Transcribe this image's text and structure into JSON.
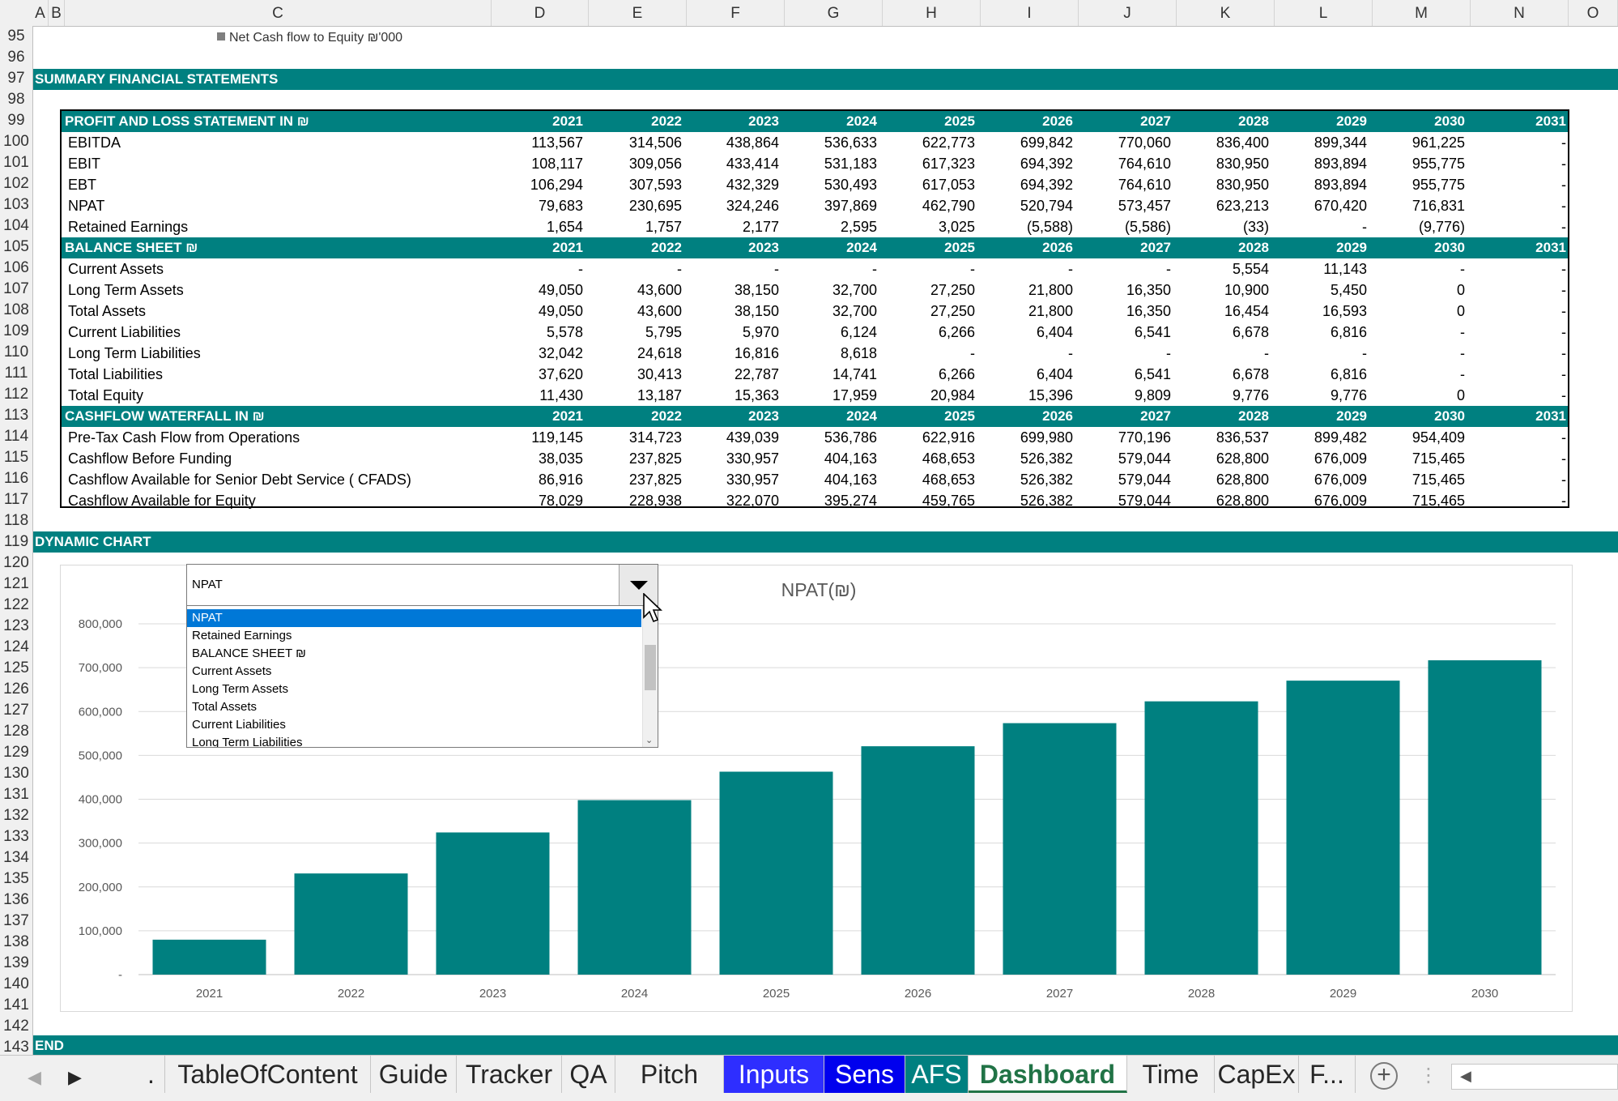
{
  "columns": [
    "A",
    "B",
    "C",
    "D",
    "E",
    "F",
    "G",
    "H",
    "I",
    "J",
    "K",
    "L",
    "M",
    "N",
    "O"
  ],
  "rows": [
    "95",
    "96",
    "97",
    "98",
    "99",
    "100",
    "101",
    "102",
    "103",
    "104",
    "105",
    "106",
    "107",
    "108",
    "109",
    "110",
    "111",
    "112",
    "113",
    "114",
    "115",
    "116",
    "117",
    "118",
    "119",
    "120",
    "121",
    "122",
    "123",
    "124",
    "125",
    "126",
    "127",
    "128",
    "129",
    "130",
    "131",
    "132",
    "133",
    "134",
    "135",
    "136",
    "137",
    "138",
    "139",
    "140",
    "141",
    "142",
    "143"
  ],
  "note": "Net Cash flow to Equity ₪'000",
  "sections": {
    "summary": "SUMMARY FINANCIAL STATEMENTS",
    "dynamic_chart": "DYNAMIC CHART",
    "end": "END"
  },
  "table": {
    "years": [
      "2021",
      "2022",
      "2023",
      "2024",
      "2025",
      "2026",
      "2027",
      "2028",
      "2029",
      "2030",
      "2031"
    ],
    "blocks": [
      {
        "title": "PROFIT AND LOSS STATEMENT IN ₪",
        "rows": [
          {
            "label": "EBITDA",
            "values": [
              "113,567",
              "314,506",
              "438,864",
              "536,633",
              "622,773",
              "699,842",
              "770,060",
              "836,400",
              "899,344",
              "961,225",
              "-"
            ]
          },
          {
            "label": "EBIT",
            "values": [
              "108,117",
              "309,056",
              "433,414",
              "531,183",
              "617,323",
              "694,392",
              "764,610",
              "830,950",
              "893,894",
              "955,775",
              "-"
            ]
          },
          {
            "label": "EBT",
            "values": [
              "106,294",
              "307,593",
              "432,329",
              "530,493",
              "617,053",
              "694,392",
              "764,610",
              "830,950",
              "893,894",
              "955,775",
              "-"
            ]
          },
          {
            "label": "NPAT",
            "values": [
              "79,683",
              "230,695",
              "324,246",
              "397,869",
              "462,790",
              "520,794",
              "573,457",
              "623,213",
              "670,420",
              "716,831",
              "-"
            ]
          },
          {
            "label": "Retained Earnings",
            "values": [
              "1,654",
              "1,757",
              "2,177",
              "2,595",
              "3,025",
              "(5,588)",
              "(5,586)",
              "(33)",
              "-",
              "(9,776)",
              "-"
            ]
          }
        ]
      },
      {
        "title": "BALANCE SHEET ₪",
        "rows": [
          {
            "label": "Current Assets",
            "values": [
              "-",
              "-",
              "-",
              "-",
              "-",
              "-",
              "-",
              "5,554",
              "11,143",
              "-",
              "-"
            ]
          },
          {
            "label": "Long Term Assets",
            "values": [
              "49,050",
              "43,600",
              "38,150",
              "32,700",
              "27,250",
              "21,800",
              "16,350",
              "10,900",
              "5,450",
              "0",
              "-"
            ]
          },
          {
            "label": "Total Assets",
            "values": [
              "49,050",
              "43,600",
              "38,150",
              "32,700",
              "27,250",
              "21,800",
              "16,350",
              "16,454",
              "16,593",
              "0",
              "-"
            ]
          },
          {
            "label": "Current Liabilities",
            "values": [
              "5,578",
              "5,795",
              "5,970",
              "6,124",
              "6,266",
              "6,404",
              "6,541",
              "6,678",
              "6,816",
              "-",
              "-"
            ]
          },
          {
            "label": "Long Term Liabilities",
            "values": [
              "32,042",
              "24,618",
              "16,816",
              "8,618",
              "-",
              "-",
              "-",
              "-",
              "-",
              "-",
              "-"
            ]
          },
          {
            "label": "Total Liabilities",
            "values": [
              "37,620",
              "30,413",
              "22,787",
              "14,741",
              "6,266",
              "6,404",
              "6,541",
              "6,678",
              "6,816",
              "-",
              "-"
            ]
          },
          {
            "label": "Total Equity",
            "values": [
              "11,430",
              "13,187",
              "15,363",
              "17,959",
              "20,984",
              "15,396",
              "9,809",
              "9,776",
              "9,776",
              "0",
              "-"
            ]
          }
        ]
      },
      {
        "title": "CASHFLOW WATERFALL IN ₪",
        "rows": [
          {
            "label": "Pre-Tax Cash Flow from Operations",
            "values": [
              "119,145",
              "314,723",
              "439,039",
              "536,786",
              "622,916",
              "699,980",
              "770,196",
              "836,537",
              "899,482",
              "954,409",
              "-"
            ]
          },
          {
            "label": "Cashflow Before Funding",
            "values": [
              "38,035",
              "237,825",
              "330,957",
              "404,163",
              "468,653",
              "526,382",
              "579,044",
              "628,800",
              "676,009",
              "715,465",
              "-"
            ]
          },
          {
            "label": "Cashflow Available for Senior Debt Service ( CFADS)",
            "values": [
              "86,916",
              "237,825",
              "330,957",
              "404,163",
              "468,653",
              "526,382",
              "579,044",
              "628,800",
              "676,009",
              "715,465",
              "-"
            ]
          },
          {
            "label": "Cashflow Available for Equity",
            "values": [
              "78,029",
              "228,938",
              "322,070",
              "395,274",
              "459,765",
              "526,382",
              "579,044",
              "628,800",
              "676,009",
              "715,465",
              "-"
            ]
          }
        ]
      }
    ]
  },
  "dropdown": {
    "selected": "NPAT",
    "options": [
      "NPAT",
      "Retained Earnings",
      "BALANCE SHEET ₪",
      "Current Assets",
      "Long Term Assets",
      "Total Assets",
      "Current Liabilities",
      "Long Term Liabilities"
    ]
  },
  "chart_data": {
    "type": "bar",
    "title": "NPAT(₪)",
    "categories": [
      "2021",
      "2022",
      "2023",
      "2024",
      "2025",
      "2026",
      "2027",
      "2028",
      "2029",
      "2030"
    ],
    "values": [
      79683,
      230695,
      324246,
      397869,
      462790,
      520794,
      573457,
      623213,
      670420,
      716831
    ],
    "ylim": [
      0,
      800000
    ],
    "yticks": [
      0,
      100000,
      200000,
      300000,
      400000,
      500000,
      600000,
      700000,
      800000
    ],
    "ytick_labels": [
      "-",
      "100,000",
      "200,000",
      "300,000",
      "400,000",
      "500,000",
      "600,000",
      "700,000",
      "800,000"
    ],
    "grid": true,
    "bar_color": "#008080"
  },
  "tabs": [
    ".",
    "TableOfContent",
    "Guide",
    "Tracker",
    "QA",
    "Pitch",
    "Inputs",
    "Sens",
    "AFS",
    "Dashboard",
    "Time",
    "CapEx",
    "F..."
  ],
  "active_tab": "Dashboard",
  "colors": {
    "teal": "#008080",
    "tab_blue": "#2e2eff",
    "tab_darkblue": "#0000ee",
    "selection": "#0078d7"
  }
}
